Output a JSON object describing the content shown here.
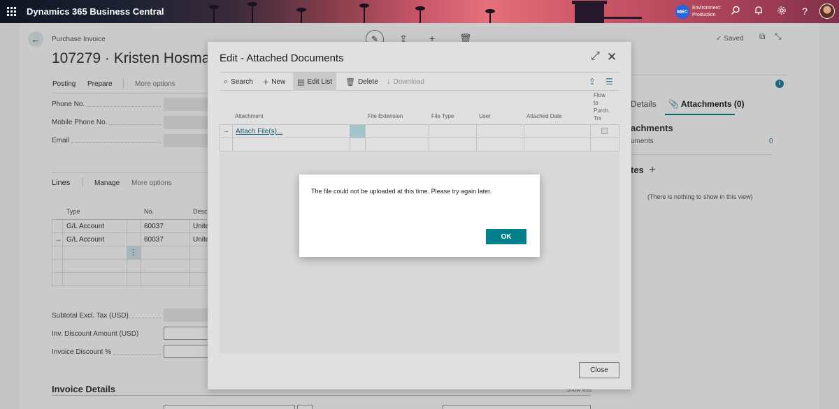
{
  "appbar": {
    "title": "Dynamics 365 Business Central",
    "env_badge": "MEC",
    "env_line1": "Environment:",
    "env_line2": "Production"
  },
  "page": {
    "breadcrumb": "Purchase Invoice",
    "record_title": "107279 · Kristen Hosman",
    "saved_label": "Saved",
    "actions": {
      "posting": "Posting",
      "prepare": "Prepare",
      "more": "More options"
    },
    "fields": {
      "phone": "Phone No.",
      "mobile": "Mobile Phone No.",
      "email": "Email",
      "subtotal": "Subtotal Excl. Tax (USD)",
      "inv_discount": "Inv. Discount Amount (USD)",
      "invoice_discount_pct": "Invoice Discount %"
    },
    "lines": {
      "title": "Lines",
      "manage": "Manage",
      "more": "More options",
      "headers": {
        "type": "Type",
        "no": "No.",
        "desc": "Descri"
      },
      "rows": [
        {
          "type": "G/L Account",
          "no": "60037",
          "desc": "Unite"
        },
        {
          "type": "G/L Account",
          "no": "60037",
          "desc": "Unite"
        }
      ]
    },
    "invoice_details": {
      "title": "Invoice Details",
      "show_less": "Show less"
    }
  },
  "factbox": {
    "tab_details": "Details",
    "tab_attachments": "Attachments (0)",
    "heading": "achments",
    "documents_label": "uments",
    "documents_count": "0",
    "notes_heading": "tes",
    "empty_note": "(There is nothing to show in this view)"
  },
  "edit_dialog": {
    "title": "Edit - Attached Documents",
    "toolbar": {
      "search": "Search",
      "new": "New",
      "edit_list": "Edit List",
      "delete": "Delete",
      "download": "Download"
    },
    "columns": {
      "attachment": "Attachment",
      "file_extension": "File Extension",
      "file_type": "File Type",
      "user": "User",
      "attached_date": "Attached Date",
      "flow1": "Flow",
      "flow2": "to",
      "flow3": "Purch.",
      "flow4": "Trx"
    },
    "attach_link": "Attach File(s)...",
    "close_label": "Close"
  },
  "message_box": {
    "text": "The file could not be uploaded at this time. Please try again later.",
    "ok_label": "OK"
  },
  "colors": {
    "accent": "#00808a",
    "link": "#1a6c88",
    "env_badge": "#2266e3"
  }
}
